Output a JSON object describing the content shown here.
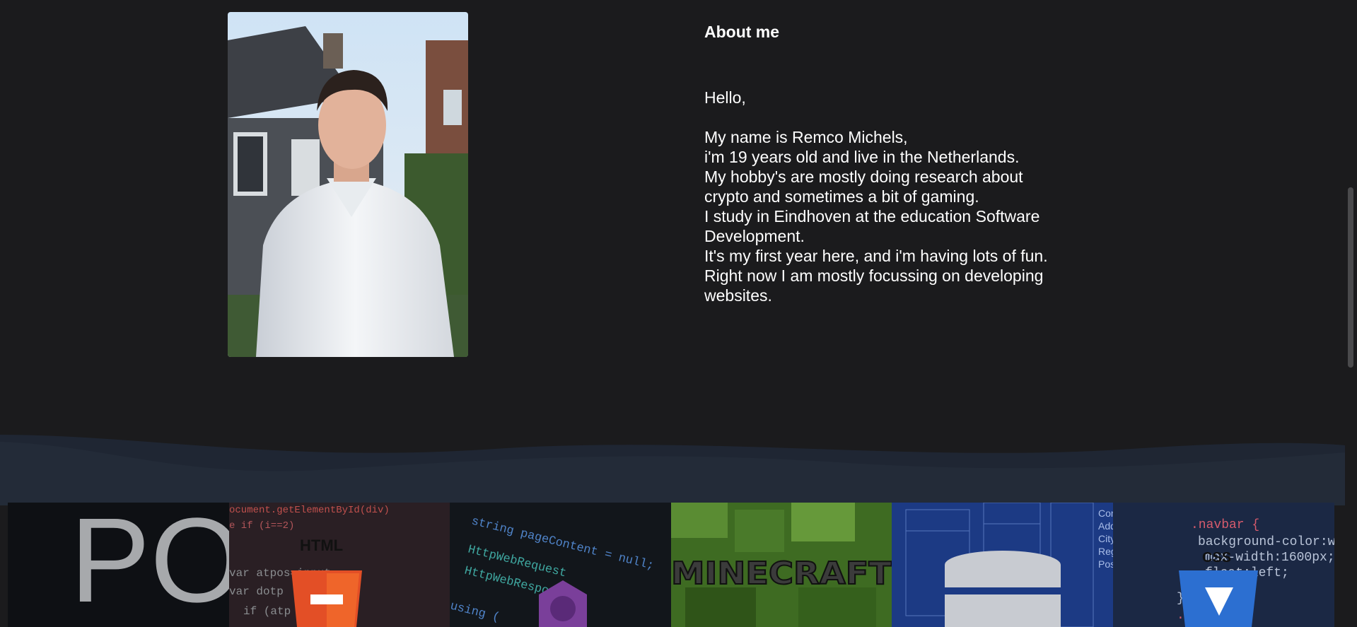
{
  "about": {
    "heading": "About me",
    "greeting": "Hello,",
    "bio": "My name is Remco Michels,\ni'm 19 years old and live in the Netherlands.\nMy hobby's are mostly doing research about\ncrypto and sometimes a bit of gaming.\nI study in Eindhoven at the education Software\nDevelopment.\nIt's my first year here, and i'm having lots of fun.\nRight now I am mostly focussing on developing\nwebsites."
  },
  "projects": {
    "pong": {
      "title": "PO"
    },
    "html": {
      "title": "HTML"
    },
    "csharp": {
      "code_lines": [
        "string pageContent = null;",
        "HttpWebRequest",
        "HttpWebResponse",
        "using ("
      ]
    },
    "minecraft": {
      "title": "MINECRAFT"
    },
    "database": {
      "words": [
        "Contact",
        "Address",
        "City",
        "Region",
        "PostalCode"
      ]
    },
    "css": {
      "title": "CSS",
      "code_lines": [
        ".navbar {",
        "background-color:white!i",
        "max-width:1600px;",
        "float:left;",
        "margin",
        "}",
        ".btn-cust"
      ]
    }
  },
  "colors": {
    "background": "#1b1b1d",
    "wave_back": "#1f2633",
    "wave_front": "#232b38",
    "html_orange": "#e34f26",
    "csharp_purple": "#7a3f9a",
    "minecraft_green": "#4f7a2a",
    "database_blue": "#1f3f88",
    "css_blue": "#2c6fd1"
  }
}
